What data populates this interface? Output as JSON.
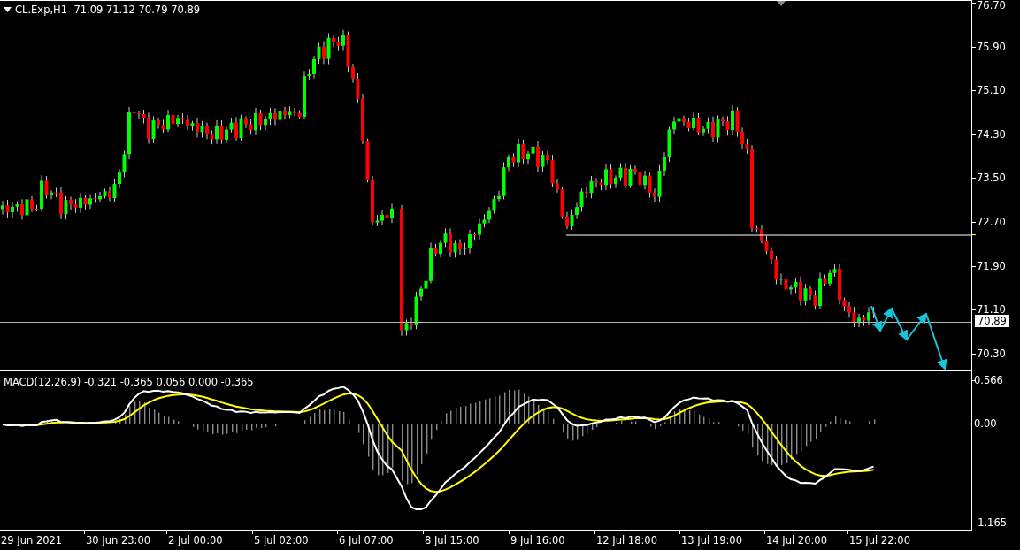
{
  "chart_header": "CL.Exp,H1  71.09 71.12 70.79 70.89",
  "price_axis": [
    "76.70",
    "75.90",
    "75.10",
    "74.30",
    "73.50",
    "72.70",
    "71.90",
    "71.10",
    "70.30"
  ],
  "current_price": "70.89",
  "indicator_header": "MACD(12,26,9) -0.321 -0.365 0.056 0.000 -0.365",
  "indicator_axis": [
    "0.566",
    "0.00",
    "-1.165"
  ],
  "time_axis": [
    "29 Jun 2021",
    "30 Jun 23:00",
    "2 Jul 00:00",
    "5 Jul 02:00",
    "6 Jul 07:00",
    "8 Jul 15:00",
    "9 Jul 16:00",
    "12 Jul 18:00",
    "13 Jul 19:00",
    "14 Jul 20:00",
    "15 Jul 22:00"
  ]
}
